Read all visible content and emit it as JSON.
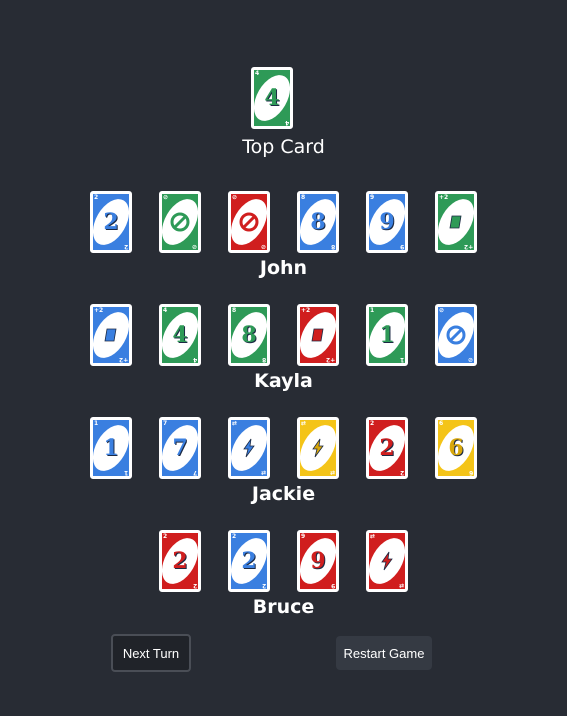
{
  "top_card": {
    "label": "Top Card",
    "card": {
      "color": "green",
      "value": "4",
      "corner": "4"
    }
  },
  "players": [
    {
      "name": "John",
      "cards": [
        {
          "color": "blue",
          "value": "2",
          "corner": "2"
        },
        {
          "color": "green",
          "value": "skip",
          "corner": "⊘"
        },
        {
          "color": "red",
          "value": "skip",
          "corner": "⊘"
        },
        {
          "color": "blue",
          "value": "8",
          "corner": "8"
        },
        {
          "color": "blue",
          "value": "9",
          "corner": "9"
        },
        {
          "color": "green",
          "value": "draw2",
          "corner": "+2"
        }
      ]
    },
    {
      "name": "Kayla",
      "cards": [
        {
          "color": "blue",
          "value": "draw2",
          "corner": "+2"
        },
        {
          "color": "green",
          "value": "4",
          "corner": "4"
        },
        {
          "color": "green",
          "value": "8",
          "corner": "8"
        },
        {
          "color": "red",
          "value": "draw2",
          "corner": "+2"
        },
        {
          "color": "green",
          "value": "1",
          "corner": "1"
        },
        {
          "color": "blue",
          "value": "skip",
          "corner": "⊘"
        }
      ]
    },
    {
      "name": "Jackie",
      "cards": [
        {
          "color": "blue",
          "value": "1",
          "corner": "1"
        },
        {
          "color": "blue",
          "value": "7",
          "corner": "7"
        },
        {
          "color": "blue",
          "value": "reverse",
          "corner": "⇄"
        },
        {
          "color": "yellow",
          "value": "reverse",
          "corner": "⇄"
        },
        {
          "color": "red",
          "value": "2",
          "corner": "2"
        },
        {
          "color": "yellow",
          "value": "6",
          "corner": "6"
        }
      ]
    },
    {
      "name": "Bruce",
      "cards": [
        {
          "color": "red",
          "value": "2",
          "corner": "2"
        },
        {
          "color": "blue",
          "value": "2",
          "corner": "2"
        },
        {
          "color": "red",
          "value": "9",
          "corner": "9"
        },
        {
          "color": "red",
          "value": "reverse",
          "corner": "⇄"
        }
      ]
    }
  ],
  "buttons": {
    "next_turn": "Next Turn",
    "restart": "Restart Game"
  },
  "colors": {
    "background": "#282c34",
    "blue": "#3a7fe0",
    "green": "#2e9a57",
    "red": "#d01e1e",
    "yellow": "#f4c418"
  }
}
